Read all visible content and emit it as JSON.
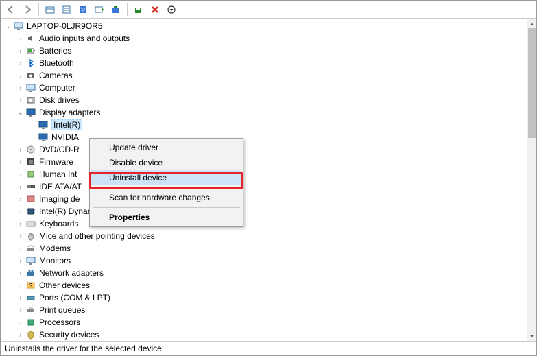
{
  "toolbar": {
    "back": "back-icon",
    "forward": "forward-icon",
    "view": "view-icon",
    "props": "properties-icon",
    "help": "help-icon",
    "find": "find-icon",
    "update": "update-icon",
    "scan": "scan-icon",
    "remove": "remove-icon",
    "opts": "options-icon"
  },
  "tree": {
    "root": {
      "label": "LAPTOP-0LJR9OR5",
      "icon": "computer-icon",
      "expanded": true
    },
    "nodes": [
      {
        "label": "Audio inputs and outputs",
        "icon": "audio-icon",
        "expanded": false
      },
      {
        "label": "Batteries",
        "icon": "battery-icon",
        "expanded": false
      },
      {
        "label": "Bluetooth",
        "icon": "bluetooth-icon",
        "expanded": false
      },
      {
        "label": "Cameras",
        "icon": "camera-icon",
        "expanded": false
      },
      {
        "label": "Computer",
        "icon": "computer-icon",
        "expanded": false
      },
      {
        "label": "Disk drives",
        "icon": "disk-icon",
        "expanded": false
      },
      {
        "label": "Display adapters",
        "icon": "display-icon",
        "expanded": true,
        "children": [
          {
            "label": "Intel(R)",
            "icon": "display-icon",
            "selected": true
          },
          {
            "label": "NVIDIA",
            "icon": "display-icon"
          }
        ]
      },
      {
        "label": "DVD/CD-R",
        "icon": "dvd-icon",
        "expanded": false
      },
      {
        "label": "Firmware",
        "icon": "firmware-icon",
        "expanded": false
      },
      {
        "label": "Human Int",
        "icon": "hid-icon",
        "expanded": false
      },
      {
        "label": "IDE ATA/AT",
        "icon": "ide-icon",
        "expanded": false
      },
      {
        "label": "Imaging de",
        "icon": "imaging-icon",
        "expanded": false
      },
      {
        "label": "Intel(R) Dynamic Platform and Thermal Framework",
        "icon": "chip-icon",
        "expanded": false
      },
      {
        "label": "Keyboards",
        "icon": "keyboard-icon",
        "expanded": false
      },
      {
        "label": "Mice and other pointing devices",
        "icon": "mouse-icon",
        "expanded": false
      },
      {
        "label": "Modems",
        "icon": "modem-icon",
        "expanded": false
      },
      {
        "label": "Monitors",
        "icon": "monitor-icon",
        "expanded": false
      },
      {
        "label": "Network adapters",
        "icon": "network-icon",
        "expanded": false
      },
      {
        "label": "Other devices",
        "icon": "other-icon",
        "expanded": false
      },
      {
        "label": "Ports (COM & LPT)",
        "icon": "port-icon",
        "expanded": false
      },
      {
        "label": "Print queues",
        "icon": "printer-icon",
        "expanded": false
      },
      {
        "label": "Processors",
        "icon": "cpu-icon",
        "expanded": false
      },
      {
        "label": "Security devices",
        "icon": "security-icon",
        "expanded": false
      }
    ]
  },
  "context_menu": {
    "items": [
      {
        "label": "Update driver",
        "bold": false
      },
      {
        "label": "Disable device",
        "bold": false
      },
      {
        "label": "Uninstall device",
        "bold": false,
        "highlighted": true,
        "hovered": true
      },
      {
        "sep": true
      },
      {
        "label": "Scan for hardware changes",
        "bold": false
      },
      {
        "sep": true
      },
      {
        "label": "Properties",
        "bold": true
      }
    ],
    "highlight_color": "#e3242b"
  },
  "statusbar": {
    "text": "Uninstalls the driver for the selected device."
  }
}
